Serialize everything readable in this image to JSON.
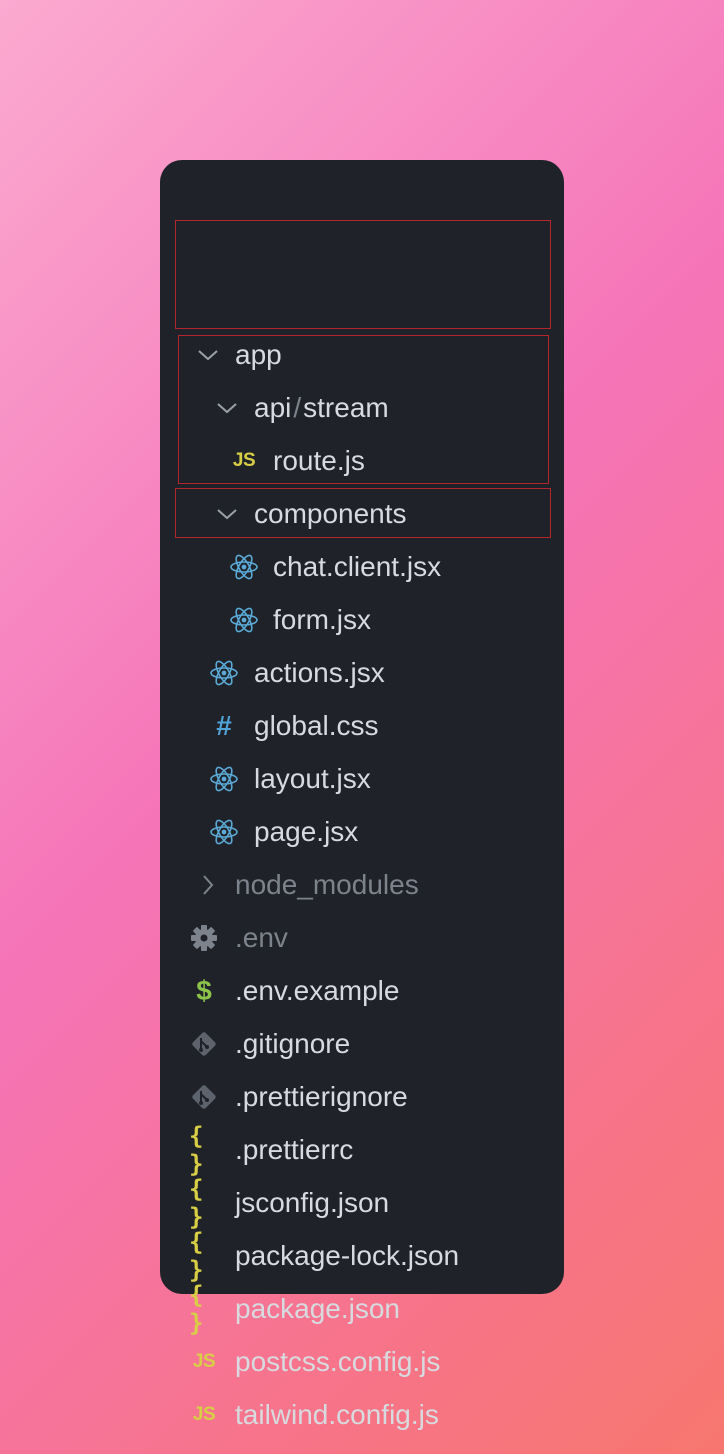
{
  "tree": {
    "app": {
      "label": "app",
      "icon": "chevron-down-icon"
    },
    "api": {
      "part1": "api",
      "separator": "/",
      "part2": "stream",
      "icon": "chevron-down-icon"
    },
    "route": {
      "label": "route.js",
      "icon": "js-file-icon",
      "icon_text": "JS"
    },
    "components": {
      "label": "components",
      "icon": "chevron-down-icon"
    },
    "chat_client": {
      "label": "chat.client.jsx",
      "icon": "react-icon"
    },
    "form": {
      "label": "form.jsx",
      "icon": "react-icon"
    },
    "actions": {
      "label": "actions.jsx",
      "icon": "react-icon"
    },
    "global_css": {
      "label": "global.css",
      "icon": "css-hash-icon",
      "icon_text": "#"
    },
    "layout": {
      "label": "layout.jsx",
      "icon": "react-icon"
    },
    "page": {
      "label": "page.jsx",
      "icon": "react-icon"
    },
    "node_modules": {
      "label": "node_modules",
      "icon": "chevron-right-icon"
    },
    "env": {
      "label": ".env",
      "icon": "gear-icon"
    },
    "env_example": {
      "label": ".env.example",
      "icon": "dollar-icon",
      "icon_text": "$"
    },
    "gitignore": {
      "label": ".gitignore",
      "icon": "git-icon"
    },
    "prettierignore": {
      "label": ".prettierignore",
      "icon": "git-icon"
    },
    "prettierrc": {
      "label": ".prettierrc",
      "icon": "json-braces-icon",
      "icon_text": "{ }"
    },
    "jsconfig": {
      "label": "jsconfig.json",
      "icon": "json-braces-icon",
      "icon_text": "{ }"
    },
    "package_lock": {
      "label": "package-lock.json",
      "icon": "json-braces-icon",
      "icon_text": "{ }"
    },
    "package": {
      "label": "package.json",
      "icon": "json-braces-icon",
      "icon_text": "{ }"
    },
    "postcss": {
      "label": "postcss.config.js",
      "icon": "js-file-icon",
      "icon_text": "JS"
    },
    "tailwind": {
      "label": "tailwind.config.js",
      "icon": "js-file-icon",
      "icon_text": "JS"
    }
  },
  "colors": {
    "panel_bg": "#1f2329",
    "text": "#d7dbe0",
    "dim_text": "#7d838c",
    "highlight_border": "#b3262e",
    "react": "#5aa9d6",
    "js": "#d8ce45",
    "css": "#4fa3d8",
    "dollar": "#8cc34a"
  }
}
